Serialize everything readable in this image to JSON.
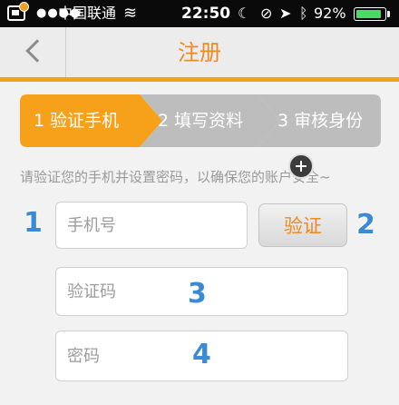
{
  "status_bar": {
    "carrier": "中国联通",
    "time": "22:50",
    "battery_percent": "92%",
    "battery_level": 0.92,
    "icons": [
      "notification-icon",
      "signal-icon",
      "wifi-icon",
      "moon-icon",
      "rotation-lock-icon",
      "location-icon",
      "bluetooth-icon",
      "battery-icon"
    ]
  },
  "nav": {
    "title": "注册",
    "back_icon": "chevron-left-icon"
  },
  "steps": [
    {
      "label": "1 验证手机",
      "active": true
    },
    {
      "label": "2 填写资料",
      "active": false
    },
    {
      "label": "3 审核身份",
      "active": false
    }
  ],
  "hint": "请验证您的手机并设置密码，以确保您的账户安全~",
  "form": {
    "phone_placeholder": "手机号",
    "verify_label": "验证",
    "code_placeholder": "验证码",
    "password_placeholder": "密码"
  },
  "markers": [
    "1",
    "2",
    "3",
    "4"
  ],
  "colors": {
    "accent": "#f7a11a",
    "title": "#f0891e",
    "step_inactive": "#bdbdbd",
    "marker": "#3a8ad6"
  }
}
